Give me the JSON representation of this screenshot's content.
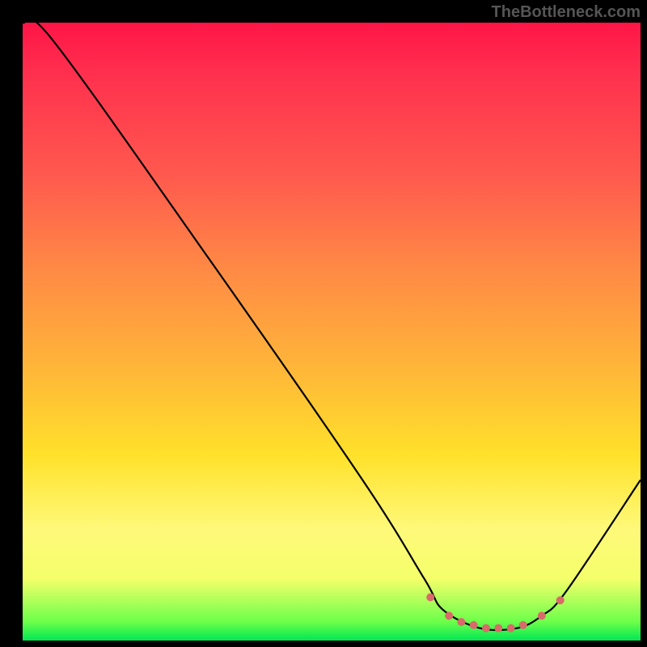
{
  "watermark": "TheBottleneck.com",
  "chart_data": {
    "type": "line",
    "title": "",
    "xlabel": "",
    "ylabel": "",
    "xlim": [
      0,
      100
    ],
    "ylim": [
      0,
      100
    ],
    "series": [
      {
        "name": "curve",
        "x": [
          0,
          5,
          30,
          55,
          65,
          68,
          74,
          80,
          84,
          88,
          100
        ],
        "y": [
          100,
          97,
          62,
          26,
          10,
          5,
          2,
          2,
          4,
          8,
          26
        ]
      }
    ],
    "markers": {
      "name": "flat-region-dots",
      "color": "#d86a6a",
      "x": [
        66,
        69,
        71,
        73,
        75,
        77,
        79,
        81,
        84,
        87
      ],
      "y": [
        7,
        4,
        3,
        2.5,
        2,
        2,
        2,
        2.5,
        4,
        6.5
      ]
    },
    "gradient_stops": [
      {
        "pos": 0,
        "color": "#ff1547"
      },
      {
        "pos": 25,
        "color": "#ff5a4e"
      },
      {
        "pos": 55,
        "color": "#ffb33a"
      },
      {
        "pos": 82,
        "color": "#fff97a"
      },
      {
        "pos": 97,
        "color": "#6cff4a"
      },
      {
        "pos": 100,
        "color": "#00e853"
      }
    ]
  }
}
